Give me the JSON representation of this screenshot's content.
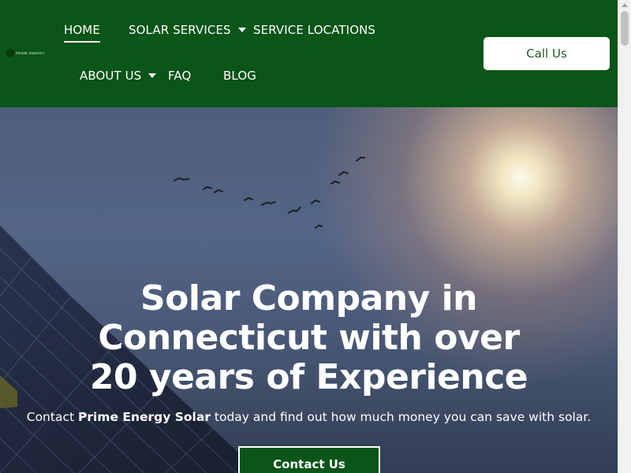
{
  "logo": {
    "text": "PRIME ENERGY"
  },
  "nav": {
    "home": "HOME",
    "solar_services": "SOLAR SERVICES",
    "service_locations": "SERVICE LOCATIONS",
    "about_us": "ABOUT US",
    "faq": "FAQ",
    "blog": "BLOG"
  },
  "header": {
    "call_label": "Call Us"
  },
  "hero": {
    "title_line1": "Solar Company in",
    "title_line2": "Connecticut with over",
    "title_line3": "20 years of Experience",
    "subtitle_prefix": "Contact ",
    "subtitle_brand": "Prime Energy Solar",
    "subtitle_suffix": " today and find out how much money you can save with solar.",
    "cta_label": "Contact Us"
  },
  "colors": {
    "header_green": "#0a5518",
    "cta_green": "#0a5518",
    "text_white": "#ffffff",
    "call_text": "#1f5a28"
  }
}
